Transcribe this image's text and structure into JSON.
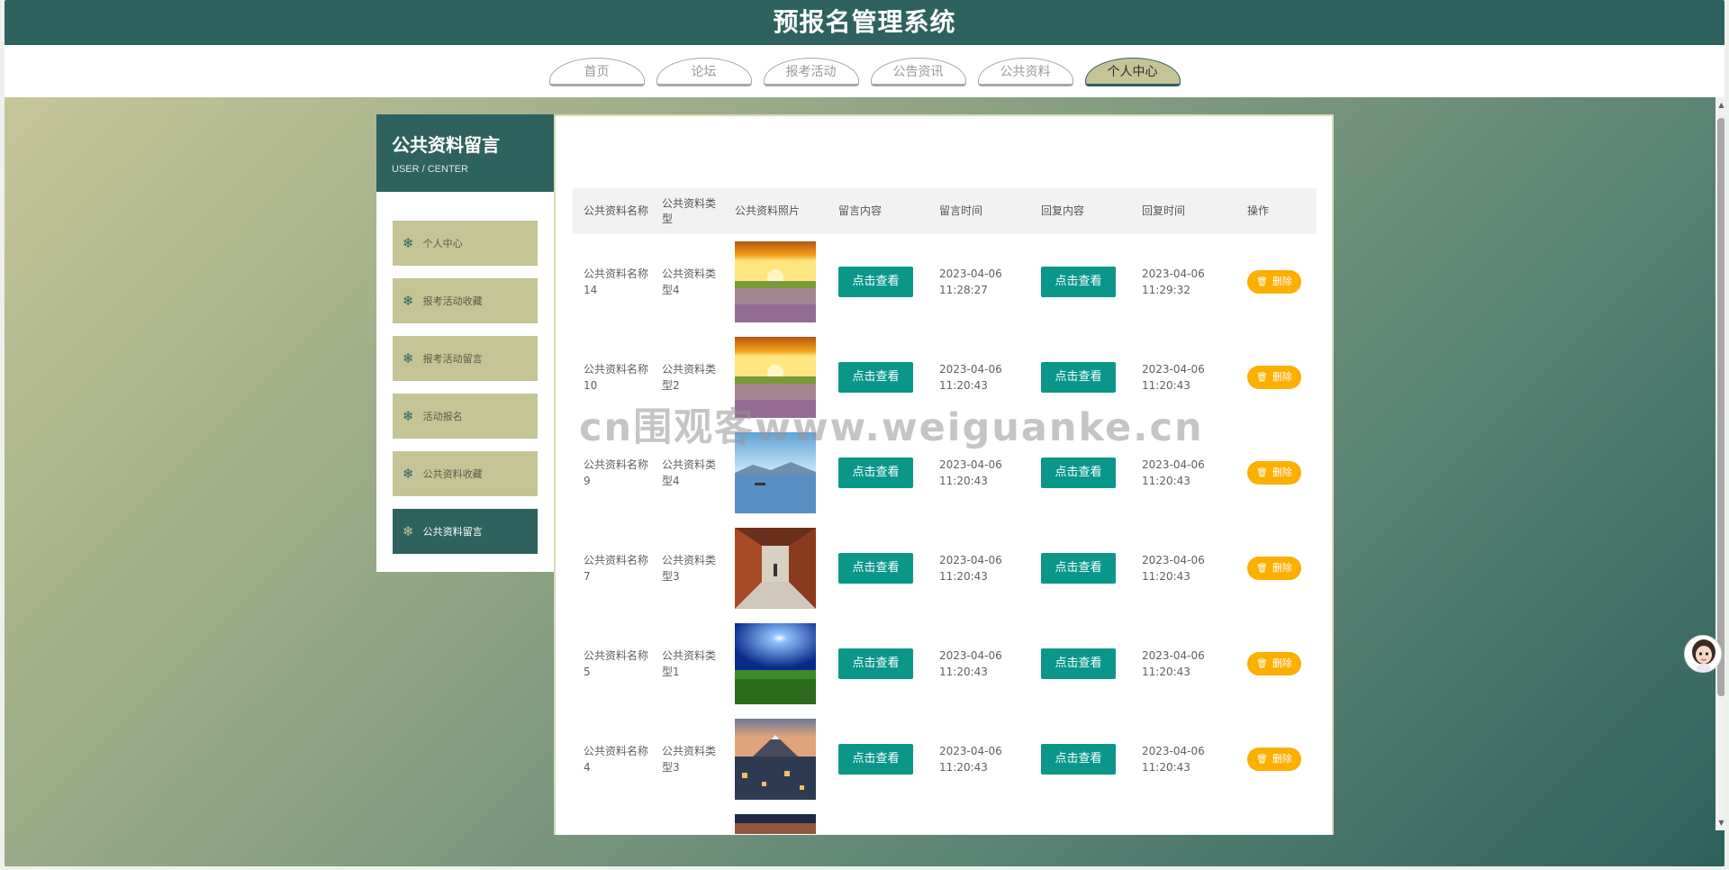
{
  "header": {
    "title": "预报名管理系统"
  },
  "nav": {
    "tabs": [
      {
        "label": "首页",
        "active": false
      },
      {
        "label": "论坛",
        "active": false
      },
      {
        "label": "报考活动",
        "active": false
      },
      {
        "label": "公告资讯",
        "active": false
      },
      {
        "label": "公共资料",
        "active": false
      },
      {
        "label": "个人中心",
        "active": true
      }
    ]
  },
  "sidebar": {
    "title": "公共资料留言",
    "subtitle": "USER / CENTER",
    "icon": "snowflake-icon",
    "items": [
      {
        "label": "个人中心",
        "active": false
      },
      {
        "label": "报考活动收藏",
        "active": false
      },
      {
        "label": "报考活动留言",
        "active": false
      },
      {
        "label": "活动报名",
        "active": false
      },
      {
        "label": "公共资料收藏",
        "active": false
      },
      {
        "label": "公共资料留言",
        "active": true
      }
    ]
  },
  "table": {
    "headers": [
      "公共资料名称",
      "公共资料类型",
      "公共资料照片",
      "留言内容",
      "留言时间",
      "回复内容",
      "回复时间",
      "操作"
    ],
    "view_label": "点击查看",
    "delete_label": "删除",
    "rows": [
      {
        "name": "公共资料名称14",
        "type": "公共资料类型4",
        "photo": "sunset-flower-field",
        "msg_time": "2023-04-06 11:28:27",
        "reply_time": "2023-04-06 11:29:32"
      },
      {
        "name": "公共资料名称10",
        "type": "公共资料类型2",
        "photo": "sunset-flower-field",
        "msg_time": "2023-04-06 11:20:43",
        "reply_time": "2023-04-06 11:20:43"
      },
      {
        "name": "公共资料名称9",
        "type": "公共资料类型4",
        "photo": "lake-mountains",
        "msg_time": "2023-04-06 11:20:43",
        "reply_time": "2023-04-06 11:20:43"
      },
      {
        "name": "公共资料名称7",
        "type": "公共资料类型3",
        "photo": "corridor",
        "msg_time": "2023-04-06 11:20:43",
        "reply_time": "2023-04-06 11:20:43"
      },
      {
        "name": "公共资料名称5",
        "type": "公共资料类型1",
        "photo": "blue-sky-grass",
        "msg_time": "2023-04-06 11:20:43",
        "reply_time": "2023-04-06 11:20:43"
      },
      {
        "name": "公共资料名称4",
        "type": "公共资料类型3",
        "photo": "mountain-city",
        "msg_time": "2023-04-06 11:20:43",
        "reply_time": "2023-04-06 11:20:43"
      }
    ]
  },
  "watermark": "cn围观客www.weiguanke.cn",
  "colors": {
    "primary": "#2e625f",
    "accent": "#c4c497",
    "view_button": "#0a978a",
    "delete_button": "#fbb000"
  }
}
